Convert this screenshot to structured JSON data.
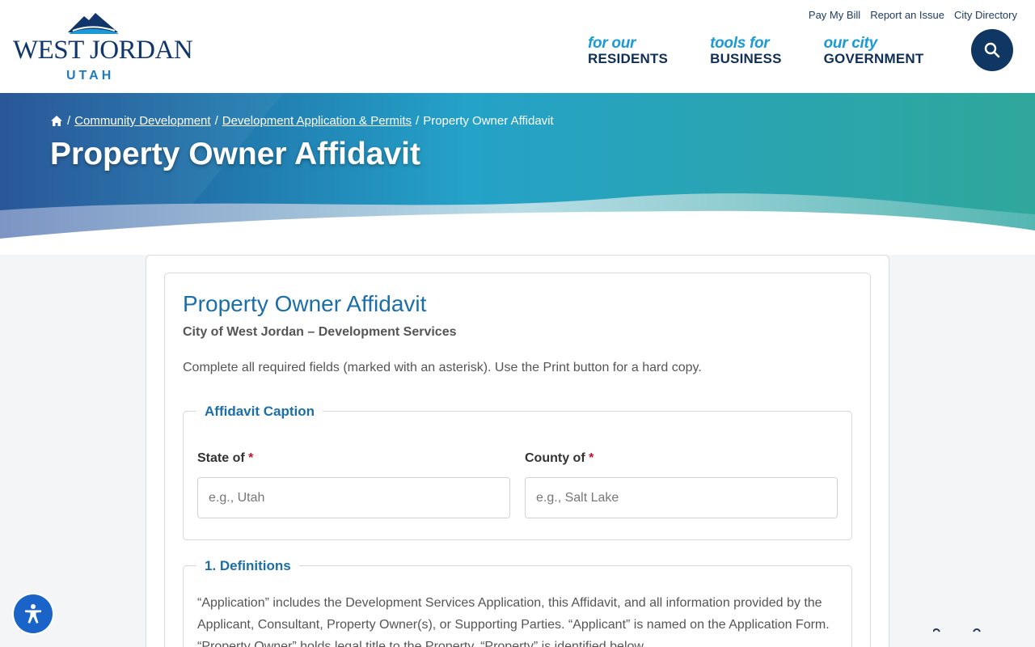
{
  "brand": {
    "name": "WEST JORDAN",
    "sub": "UTAH",
    "colors": {
      "navy": "#11366b",
      "accent": "#1a9ad6"
    }
  },
  "utility_links": [
    "Pay My Bill",
    "Report an Issue",
    "City Directory"
  ],
  "nav": [
    {
      "top": "for our",
      "bottom": "RESIDENTS"
    },
    {
      "top": "tools for",
      "bottom": "BUSINESS"
    },
    {
      "top": "our city",
      "bottom": "GOVERNMENT"
    }
  ],
  "search": {
    "icon": "search-icon"
  },
  "breadcrumb": {
    "home_icon": "home-icon",
    "sep": "/",
    "links": [
      "Community Development",
      "Development Application & Permits"
    ],
    "current": "Property Owner Affidavit"
  },
  "page_title": "Property Owner Affidavit",
  "form": {
    "title": "Property Owner Affidavit",
    "subtitle": "City of West Jordan – Development Services",
    "intro": "Complete all required fields (marked with an asterisk). Use the Print button for a hard copy.",
    "caption": {
      "legend": "Affidavit Caption",
      "state_label": "State of",
      "state_placeholder": "e.g., Utah",
      "county_label": "County of",
      "county_placeholder": "e.g., Salt Lake",
      "required_mark": "*"
    },
    "definitions": {
      "legend": "1. Definitions",
      "text": "“Application” includes the Development Services Application, this Affidavit, and all information provided by the Applicant, Consultant, Property Owner(s), or Supporting Parties. “Applicant” is named on the Application Form. “Property Owner” holds legal title to the Property. “Property” is identified below."
    }
  },
  "accessibility": {
    "icon": "accessibility-icon"
  }
}
